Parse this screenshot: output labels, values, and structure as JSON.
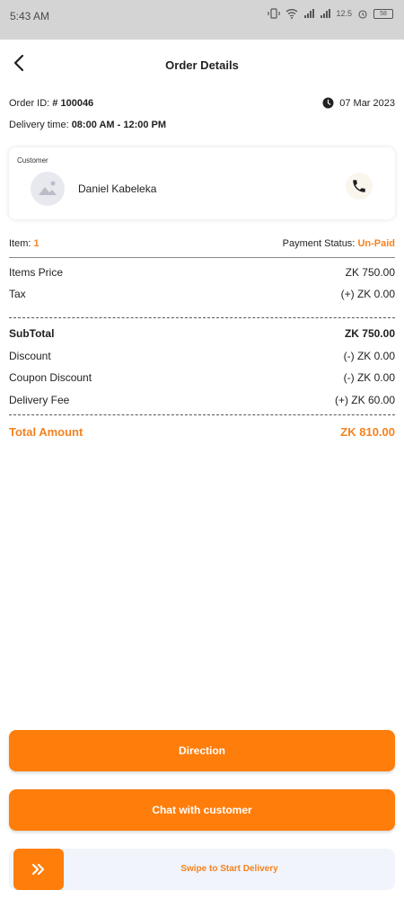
{
  "status_bar": {
    "time": "5:43 AM",
    "battery": "58",
    "speed": "12.5"
  },
  "header": {
    "title": "Order Details"
  },
  "order": {
    "id_label": "Order ID:",
    "id_value": "# 100046",
    "date": "07 Mar 2023",
    "delivery_time_label": "Delivery time:",
    "delivery_time_value": "08:00 AM - 12:00 PM"
  },
  "customer": {
    "label": "Customer",
    "name": "Daniel Kabeleka"
  },
  "items_summary": {
    "item_label": "Item:",
    "item_count": "1",
    "payment_status_label": "Payment Status:",
    "payment_status_value": "Un-Paid"
  },
  "price_lines": [
    {
      "label": "Items Price",
      "value": "ZK 750.00"
    },
    {
      "label": "Tax",
      "value": "(+) ZK 0.00"
    }
  ],
  "subtotal": {
    "label": "SubTotal",
    "value": "ZK 750.00"
  },
  "adjustments": [
    {
      "label": "Discount",
      "value": "(-) ZK 0.00"
    },
    {
      "label": "Coupon Discount",
      "value": "(-) ZK 0.00"
    },
    {
      "label": "Delivery Fee",
      "value": "(+) ZK 60.00"
    }
  ],
  "total": {
    "label": "Total Amount",
    "value": "ZK 810.00"
  },
  "actions": {
    "direction_label": "Direction",
    "chat_label": "Chat with customer",
    "swipe_label": "Swipe to Start Delivery"
  },
  "colors": {
    "accent": "#ff7d0a",
    "accent_text": "#f58220"
  }
}
